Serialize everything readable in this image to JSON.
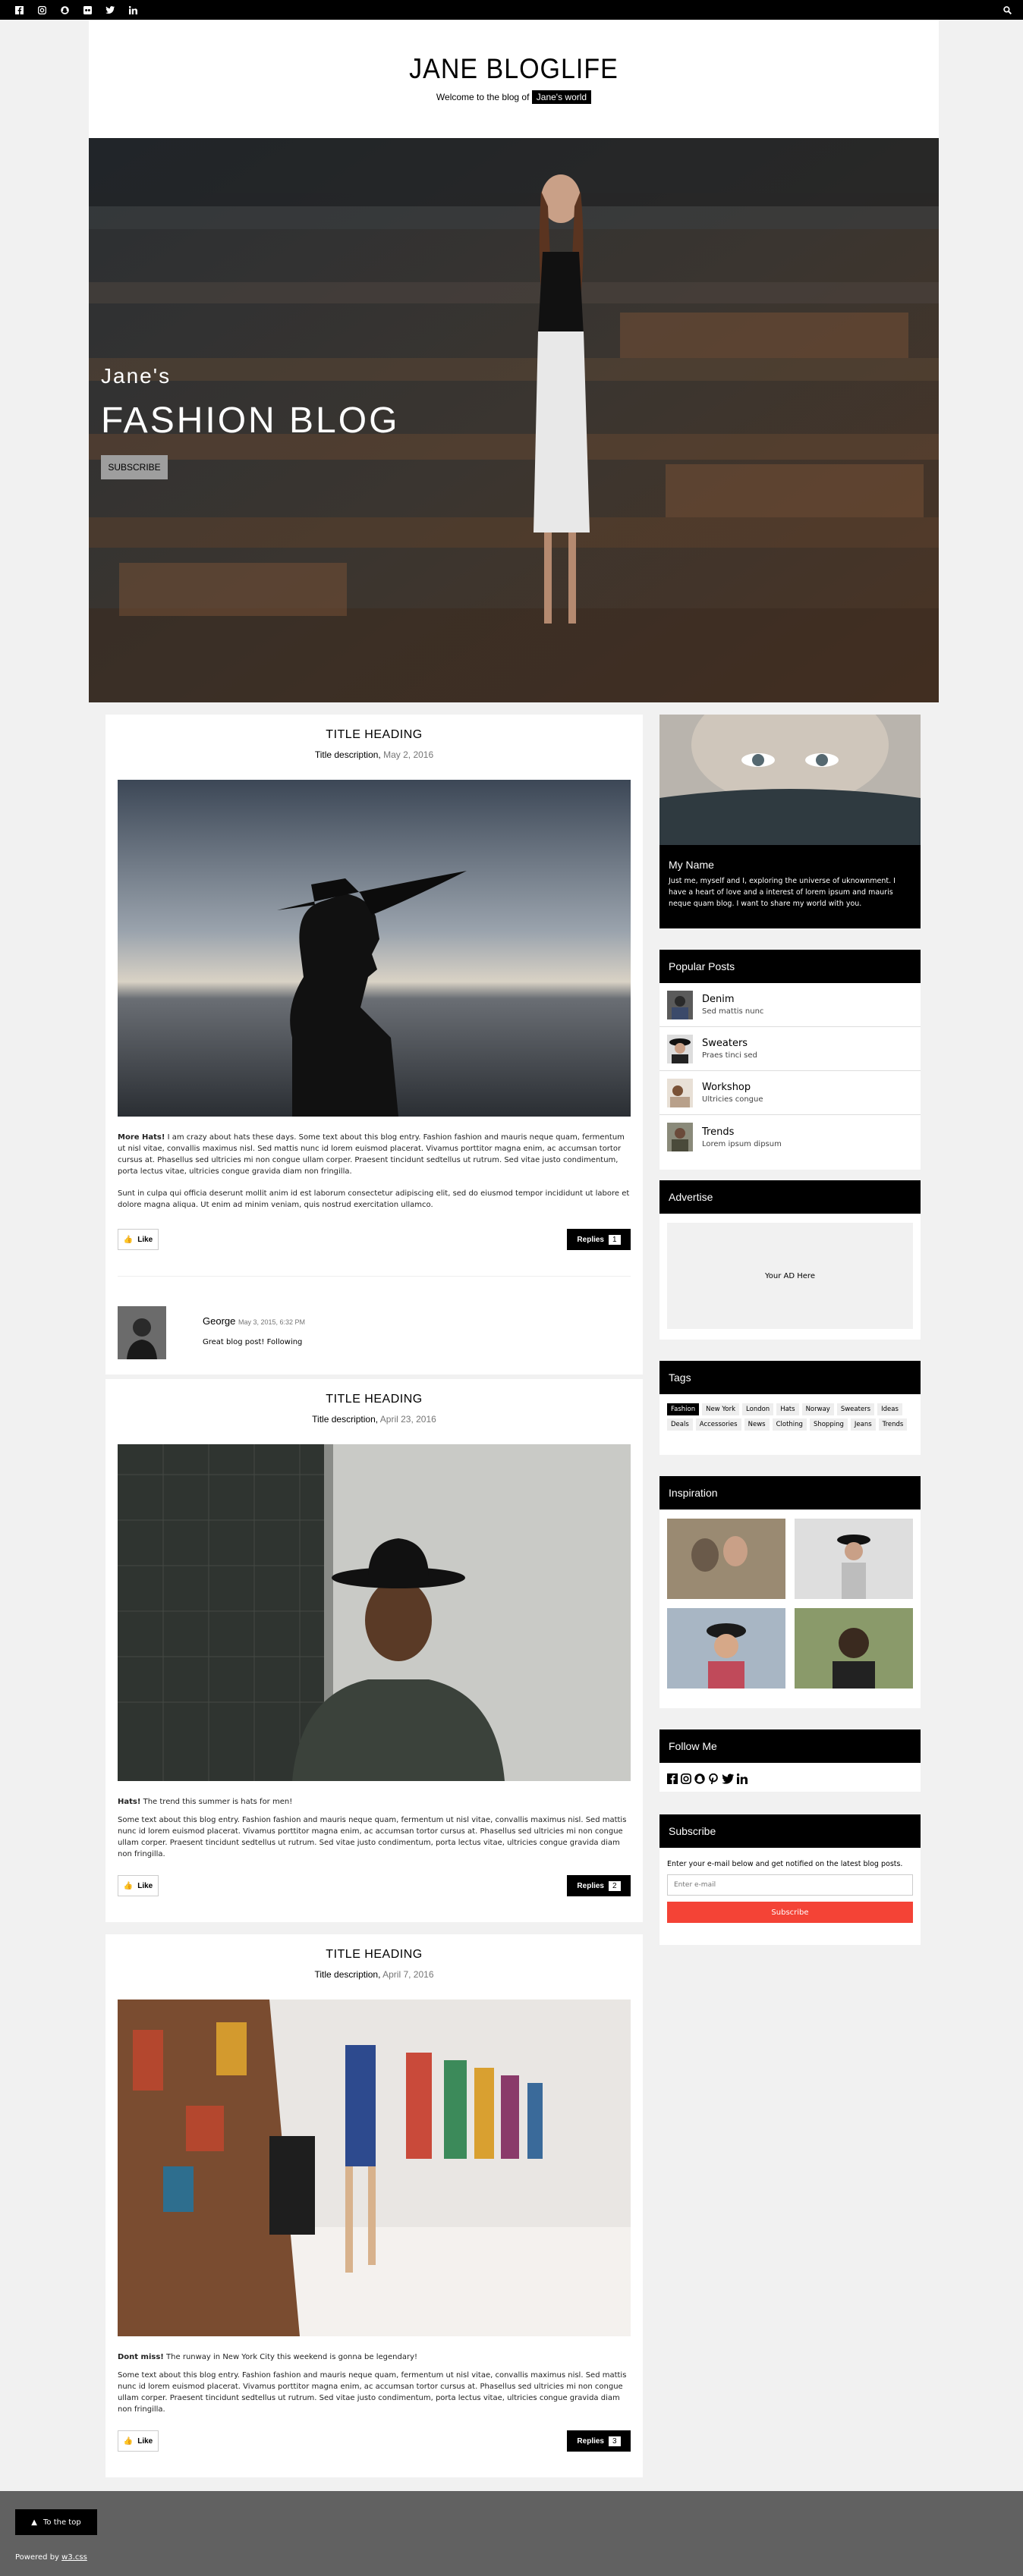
{
  "topbar": {
    "icons": [
      "facebook-icon",
      "instagram-icon",
      "snapchat-icon",
      "flickr-icon",
      "twitter-icon",
      "linkedin-icon"
    ],
    "search_icon": "search-icon"
  },
  "header": {
    "title": "JANE BLOGLIFE",
    "tagline_prefix": "Welcome to the blog of",
    "tagline_highlight": "Jane's world"
  },
  "hero": {
    "pre_title": "Jane's",
    "title": "FASHION BLOG",
    "button": "SUBSCRIBE"
  },
  "posts": [
    {
      "title": "TITLE HEADING",
      "desc_label": "Title description,",
      "desc_date": "May 2, 2016",
      "intro_bold": "More Hats!",
      "intro_text": " I am crazy about hats these days. Some text about this blog entry. Fashion fashion and mauris neque quam, fermentum ut nisl vitae, convallis maximus nisl. Sed mattis nunc id lorem euismod placerat. Vivamus porttitor magna enim, ac accumsan tortor cursus at. Phasellus sed ultricies mi non congue ullam corper. Praesent tincidunt sedtellus ut rutrum. Sed vitae justo condimentum, porta lectus vitae, ultricies congue gravida diam non fringilla.",
      "body": "Sunt in culpa qui officia deserunt mollit anim id est laborum consectetur adipiscing elit, sed do eiusmod tempor incididunt ut labore et dolore magna aliqua. Ut enim ad minim veniam, quis nostrud exercitation ullamco.",
      "like": "Like",
      "replies": "Replies",
      "reply_count": "1",
      "comment": {
        "name": "George",
        "date": "May 3, 2015, 6:32 PM",
        "text": "Great blog post! Following"
      }
    },
    {
      "title": "TITLE HEADING",
      "desc_label": "Title description,",
      "desc_date": "April 23, 2016",
      "intro_bold": "Hats!",
      "intro_text": " The trend this summer is hats for men!",
      "body": "Some text about this blog entry. Fashion fashion and mauris neque quam, fermentum ut nisl vitae, convallis maximus nisl. Sed mattis nunc id lorem euismod placerat. Vivamus porttitor magna enim, ac accumsan tortor cursus at. Phasellus sed ultricies mi non congue ullam corper. Praesent tincidunt sedtellus ut rutrum. Sed vitae justo condimentum, porta lectus vitae, ultricies congue gravida diam non fringilla.",
      "like": "Like",
      "replies": "Replies",
      "reply_count": "2"
    },
    {
      "title": "TITLE HEADING",
      "desc_label": "Title description,",
      "desc_date": "April 7, 2016",
      "intro_bold": "Dont miss!",
      "intro_text": " The runway in New York City this weekend is gonna be legendary!",
      "body": "Some text about this blog entry. Fashion fashion and mauris neque quam, fermentum ut nisl vitae, convallis maximus nisl. Sed mattis nunc id lorem euismod placerat. Vivamus porttitor magna enim, ac accumsan tortor cursus at. Phasellus sed ultricies mi non congue ullam corper. Praesent tincidunt sedtellus ut rutrum. Sed vitae justo condimentum, porta lectus vitae, ultricies congue gravida diam non fringilla.",
      "like": "Like",
      "replies": "Replies",
      "reply_count": "3"
    }
  ],
  "sidebar": {
    "about": {
      "name": "My Name",
      "text": "Just me, myself and I, exploring the universe of uknownment. I have a heart of love and a interest of lorem ipsum and mauris neque quam blog. I want to share my world with you."
    },
    "popular": {
      "title": "Popular Posts",
      "items": [
        {
          "title": "Denim",
          "sub": "Sed mattis nunc"
        },
        {
          "title": "Sweaters",
          "sub": "Praes tinci sed"
        },
        {
          "title": "Workshop",
          "sub": "Ultricies congue"
        },
        {
          "title": "Trends",
          "sub": "Lorem ipsum dipsum"
        }
      ]
    },
    "advertise": {
      "title": "Advertise",
      "ad": "Your AD Here"
    },
    "tags": {
      "title": "Tags",
      "items": [
        "Fashion",
        "New York",
        "London",
        "Hats",
        "Norway",
        "Sweaters",
        "Ideas",
        "Deals",
        "Accessories",
        "News",
        "Clothing",
        "Shopping",
        "Jeans",
        "Trends"
      ]
    },
    "inspiration": {
      "title": "Inspiration"
    },
    "follow": {
      "title": "Follow Me",
      "icons": [
        "facebook-icon",
        "instagram-icon",
        "snapchat-icon",
        "pinterest-icon",
        "twitter-icon",
        "linkedin-icon"
      ]
    },
    "subscribe": {
      "title": "Subscribe",
      "text": "Enter your e-mail below and get notified on the latest blog posts.",
      "placeholder": "Enter e-mail",
      "button": "Subscribe",
      "button_color": "#f44336"
    }
  },
  "footer": {
    "to_top": "To the top",
    "powered_prefix": "Powered by",
    "powered_link": "w3.css"
  }
}
